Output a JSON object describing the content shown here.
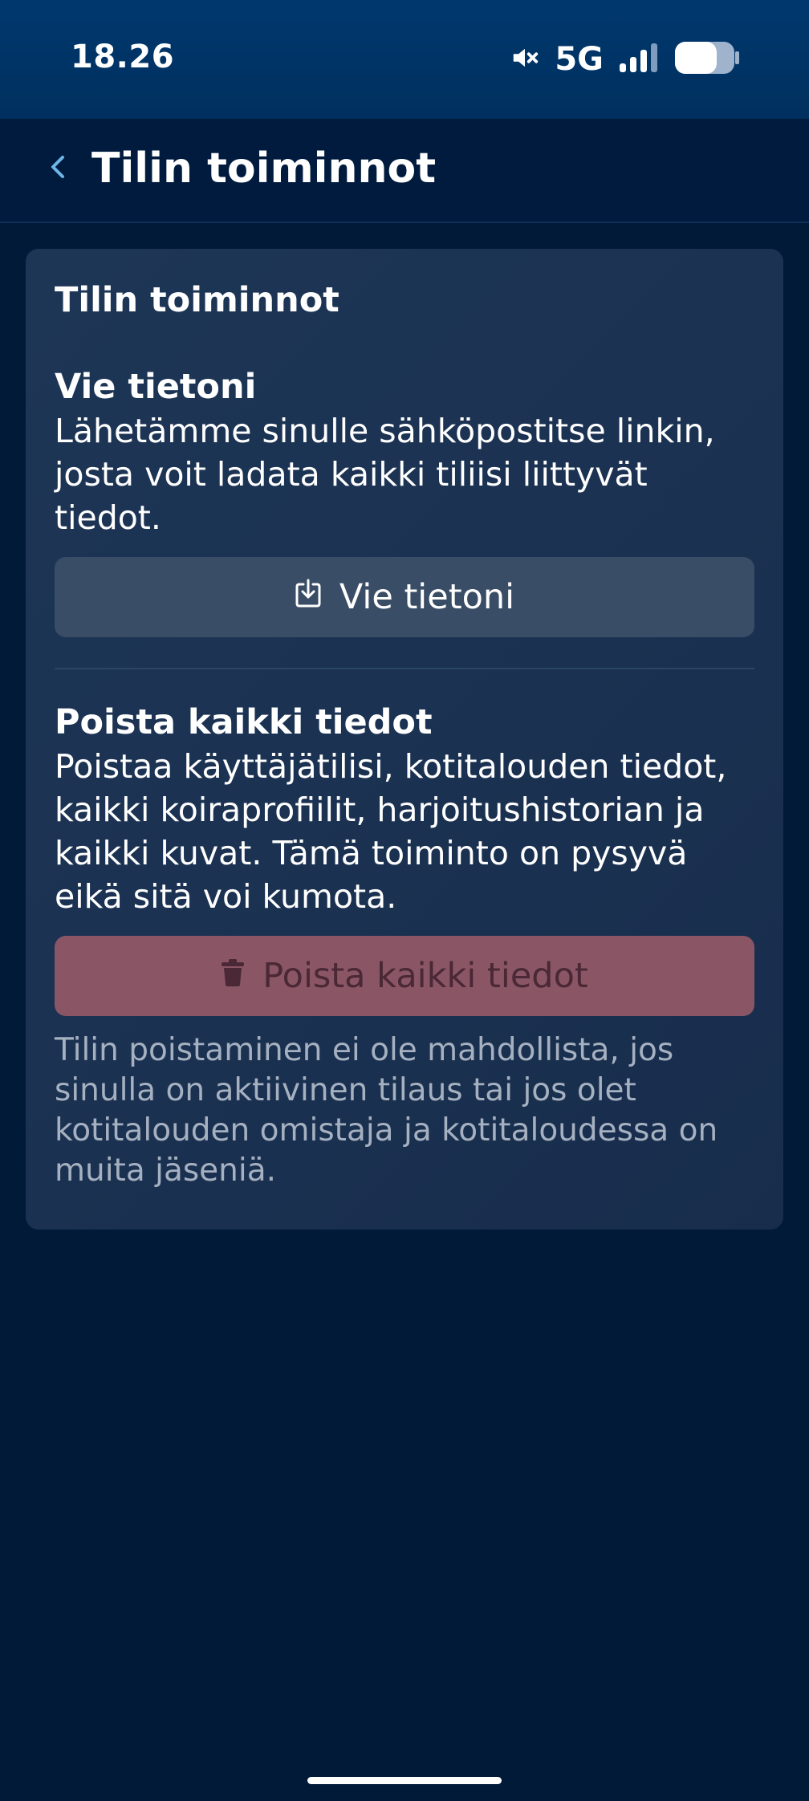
{
  "status_bar": {
    "time": "18.26",
    "network": "5G",
    "icons": [
      "mute-icon",
      "signal-icon",
      "battery-icon"
    ]
  },
  "header": {
    "back_icon": "chevron-left-icon",
    "title": "Tilin toiminnot"
  },
  "card": {
    "title": "Tilin toiminnot",
    "export": {
      "title": "Vie tietoni",
      "description": "Lähetämme sinulle sähköpostitse linkin, josta voit ladata kaikki tiliisi liittyvät tiedot.",
      "button_label": "Vie tietoni",
      "button_icon": "download-icon"
    },
    "delete": {
      "title": "Poista kaikki tiedot",
      "description": "Poistaa käyttäjätilisi, kotitalouden tiedot, kaikki koiraprofiilit, harjoitushistorian ja kaikki kuvat. Tämä toiminto on pysyvä eikä sitä voi kumota.",
      "button_label": "Poista kaikki tiedot",
      "button_icon": "trash-icon",
      "note": "Tilin poistaminen ei ole mahdollista, jos sinulla on aktiivinen tilaus tai jos olet kotitalouden omistaja ja kotitaloudessa on muita jäseniä."
    }
  },
  "colors": {
    "background": "#001a38",
    "status_bar": "#00386e",
    "card": "#1b3252",
    "export_button": "#3a4d66",
    "delete_button": "#8a5665",
    "accent": "#6fb6e8"
  }
}
